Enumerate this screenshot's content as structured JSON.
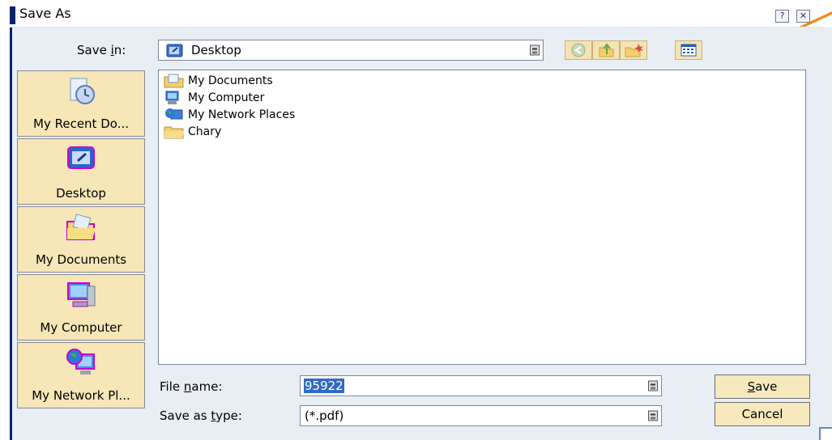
{
  "window": {
    "title": "Save As",
    "help_label": "?",
    "close_label": "✕"
  },
  "save_in": {
    "label_pre": "Save ",
    "label_ul": "i",
    "label_post": "n:",
    "value": "Desktop"
  },
  "toolbar": {
    "icons": [
      "back-icon",
      "up-folder-icon",
      "new-folder-icon",
      "view-menu-icon"
    ]
  },
  "places": [
    {
      "label": "My Recent Do...",
      "icon": "recent-documents-icon"
    },
    {
      "label": "Desktop",
      "icon": "desktop-icon"
    },
    {
      "label": "My Documents",
      "icon": "my-documents-icon"
    },
    {
      "label": "My Computer",
      "icon": "my-computer-icon"
    },
    {
      "label": "My Network Pl...",
      "icon": "my-network-places-icon"
    }
  ],
  "files": [
    {
      "name": "My Documents",
      "icon": "my-documents-icon"
    },
    {
      "name": "My Computer",
      "icon": "my-computer-icon"
    },
    {
      "name": "My Network Places",
      "icon": "network-places-icon"
    },
    {
      "name": "Chary",
      "icon": "folder-icon"
    }
  ],
  "file_name": {
    "label_pre": "File ",
    "label_ul": "n",
    "label_post": "ame:",
    "value": "95922"
  },
  "save_type": {
    "label_pre": "Save as ",
    "label_ul": "t",
    "label_post": "ype:",
    "value": "(*.pdf)"
  },
  "buttons": {
    "save_ul": "S",
    "save_rest": "ave",
    "cancel": "Cancel"
  },
  "colors": {
    "title_accent": "#0a246a",
    "button_face": "#f7e8be",
    "places_face": "#f6e6b8",
    "selection": "#316ac5",
    "title_swoosh": "#f28b1e"
  }
}
